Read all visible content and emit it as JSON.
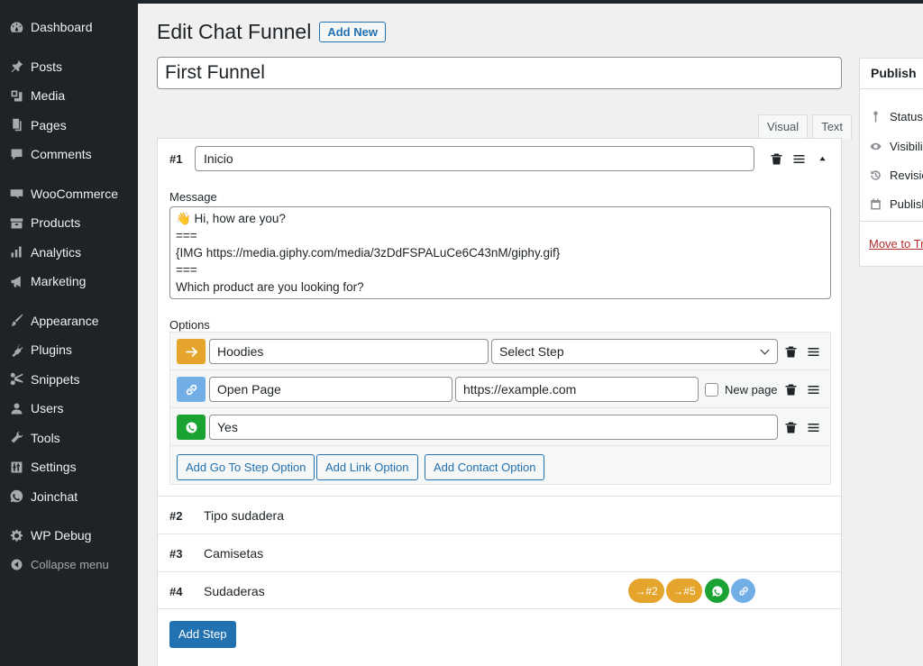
{
  "sidebar": {
    "items": [
      {
        "label": "Dashboard",
        "icon": "dashboard-icon"
      },
      {
        "label": "Posts",
        "icon": "pin-icon"
      },
      {
        "label": "Media",
        "icon": "media-icon"
      },
      {
        "label": "Pages",
        "icon": "pages-icon"
      },
      {
        "label": "Comments",
        "icon": "comment-icon"
      },
      {
        "label": "WooCommerce",
        "icon": "woo-icon"
      },
      {
        "label": "Products",
        "icon": "archive-icon"
      },
      {
        "label": "Analytics",
        "icon": "bar-chart-icon"
      },
      {
        "label": "Marketing",
        "icon": "megaphone-icon"
      },
      {
        "label": "Appearance",
        "icon": "brush-icon"
      },
      {
        "label": "Plugins",
        "icon": "plug-icon"
      },
      {
        "label": "Snippets",
        "icon": "scissors-icon"
      },
      {
        "label": "Users",
        "icon": "user-icon"
      },
      {
        "label": "Tools",
        "icon": "wrench-icon"
      },
      {
        "label": "Settings",
        "icon": "sliders-icon"
      },
      {
        "label": "Joinchat",
        "icon": "whatsapp-icon"
      },
      {
        "label": "WP Debug",
        "icon": "gear-icon"
      },
      {
        "label": "Collapse menu",
        "icon": "collapse-icon"
      }
    ]
  },
  "header": {
    "title": "Edit Chat Funnel",
    "add_new_label": "Add New"
  },
  "post_title": "First Funnel",
  "editor_tabs": [
    "Visual",
    "Text"
  ],
  "step1": {
    "number": "#1",
    "name": "Inicio",
    "message_label": "Message",
    "message": "👋 Hi, how are you?\n===\n{IMG https://media.giphy.com/media/3zDdFSPALuCe6C43nM/giphy.gif}\n===\nWhich product are you looking for?",
    "options_label": "Options",
    "options": [
      {
        "type": "step",
        "text": "Hoodies",
        "select": "Select Step"
      },
      {
        "type": "link",
        "text": "Open Page",
        "url": "https://example.com",
        "new_page_label": "New page"
      },
      {
        "type": "contact",
        "text": "Yes"
      }
    ],
    "buttons": {
      "add_step_option": "Add Go To Step Option",
      "add_link_option": "Add Link Option",
      "add_contact_option": "Add Contact Option"
    }
  },
  "steps": [
    {
      "number": "#2",
      "name": "Tipo sudadera"
    },
    {
      "number": "#3",
      "name": "Camisetas"
    },
    {
      "number": "#4",
      "name": "Sudaderas",
      "pills": [
        "→#2",
        "→#5"
      ]
    }
  ],
  "add_step_label": "Add Step",
  "publish": {
    "title": "Publish",
    "rows": [
      "Status",
      "Visibili",
      "Revisio",
      "Publish"
    ],
    "trash_link": "Move to Tr"
  },
  "colors": {
    "sidebar_bg": "#1d2327",
    "accent": "#2271b1",
    "step_option": "#e5a52c",
    "link_option": "#72aee6",
    "contact_option": "#1aa333"
  }
}
